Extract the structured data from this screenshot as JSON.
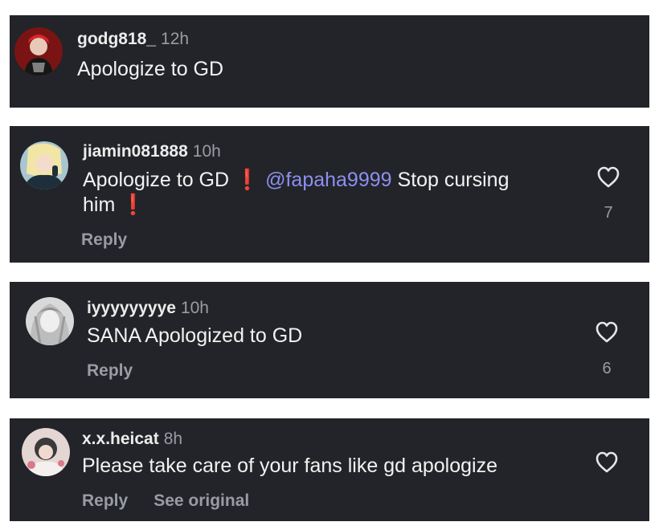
{
  "comments": [
    {
      "username": "godg818_",
      "time": "12h",
      "text": "Apologize to GD"
    },
    {
      "username": "jiamin081888",
      "time": "10h",
      "text_part1": "Apologize to GD",
      "excl1": "❗",
      "mention": "@fapaha9999",
      "text_part2": "Stop cursing",
      "text_part3": "him",
      "excl2": "❗",
      "reply_label": "Reply",
      "like_count": "7"
    },
    {
      "username": "iyyyyyyyye",
      "time": "10h",
      "text": "SANA Apologized to GD",
      "reply_label": "Reply",
      "like_count": "6"
    },
    {
      "username": "x.x.heicat",
      "time": "8h",
      "text": "Please take care of your fans like gd apologize",
      "reply_label": "Reply",
      "see_original_label": "See original"
    }
  ],
  "icons": {
    "like": "heart-outline-icon"
  },
  "colors": {
    "card_bg": "#222429",
    "mention": "#8d8ff0",
    "secondary_text": "#9a9ca3",
    "exclamation": "#e0282d"
  }
}
